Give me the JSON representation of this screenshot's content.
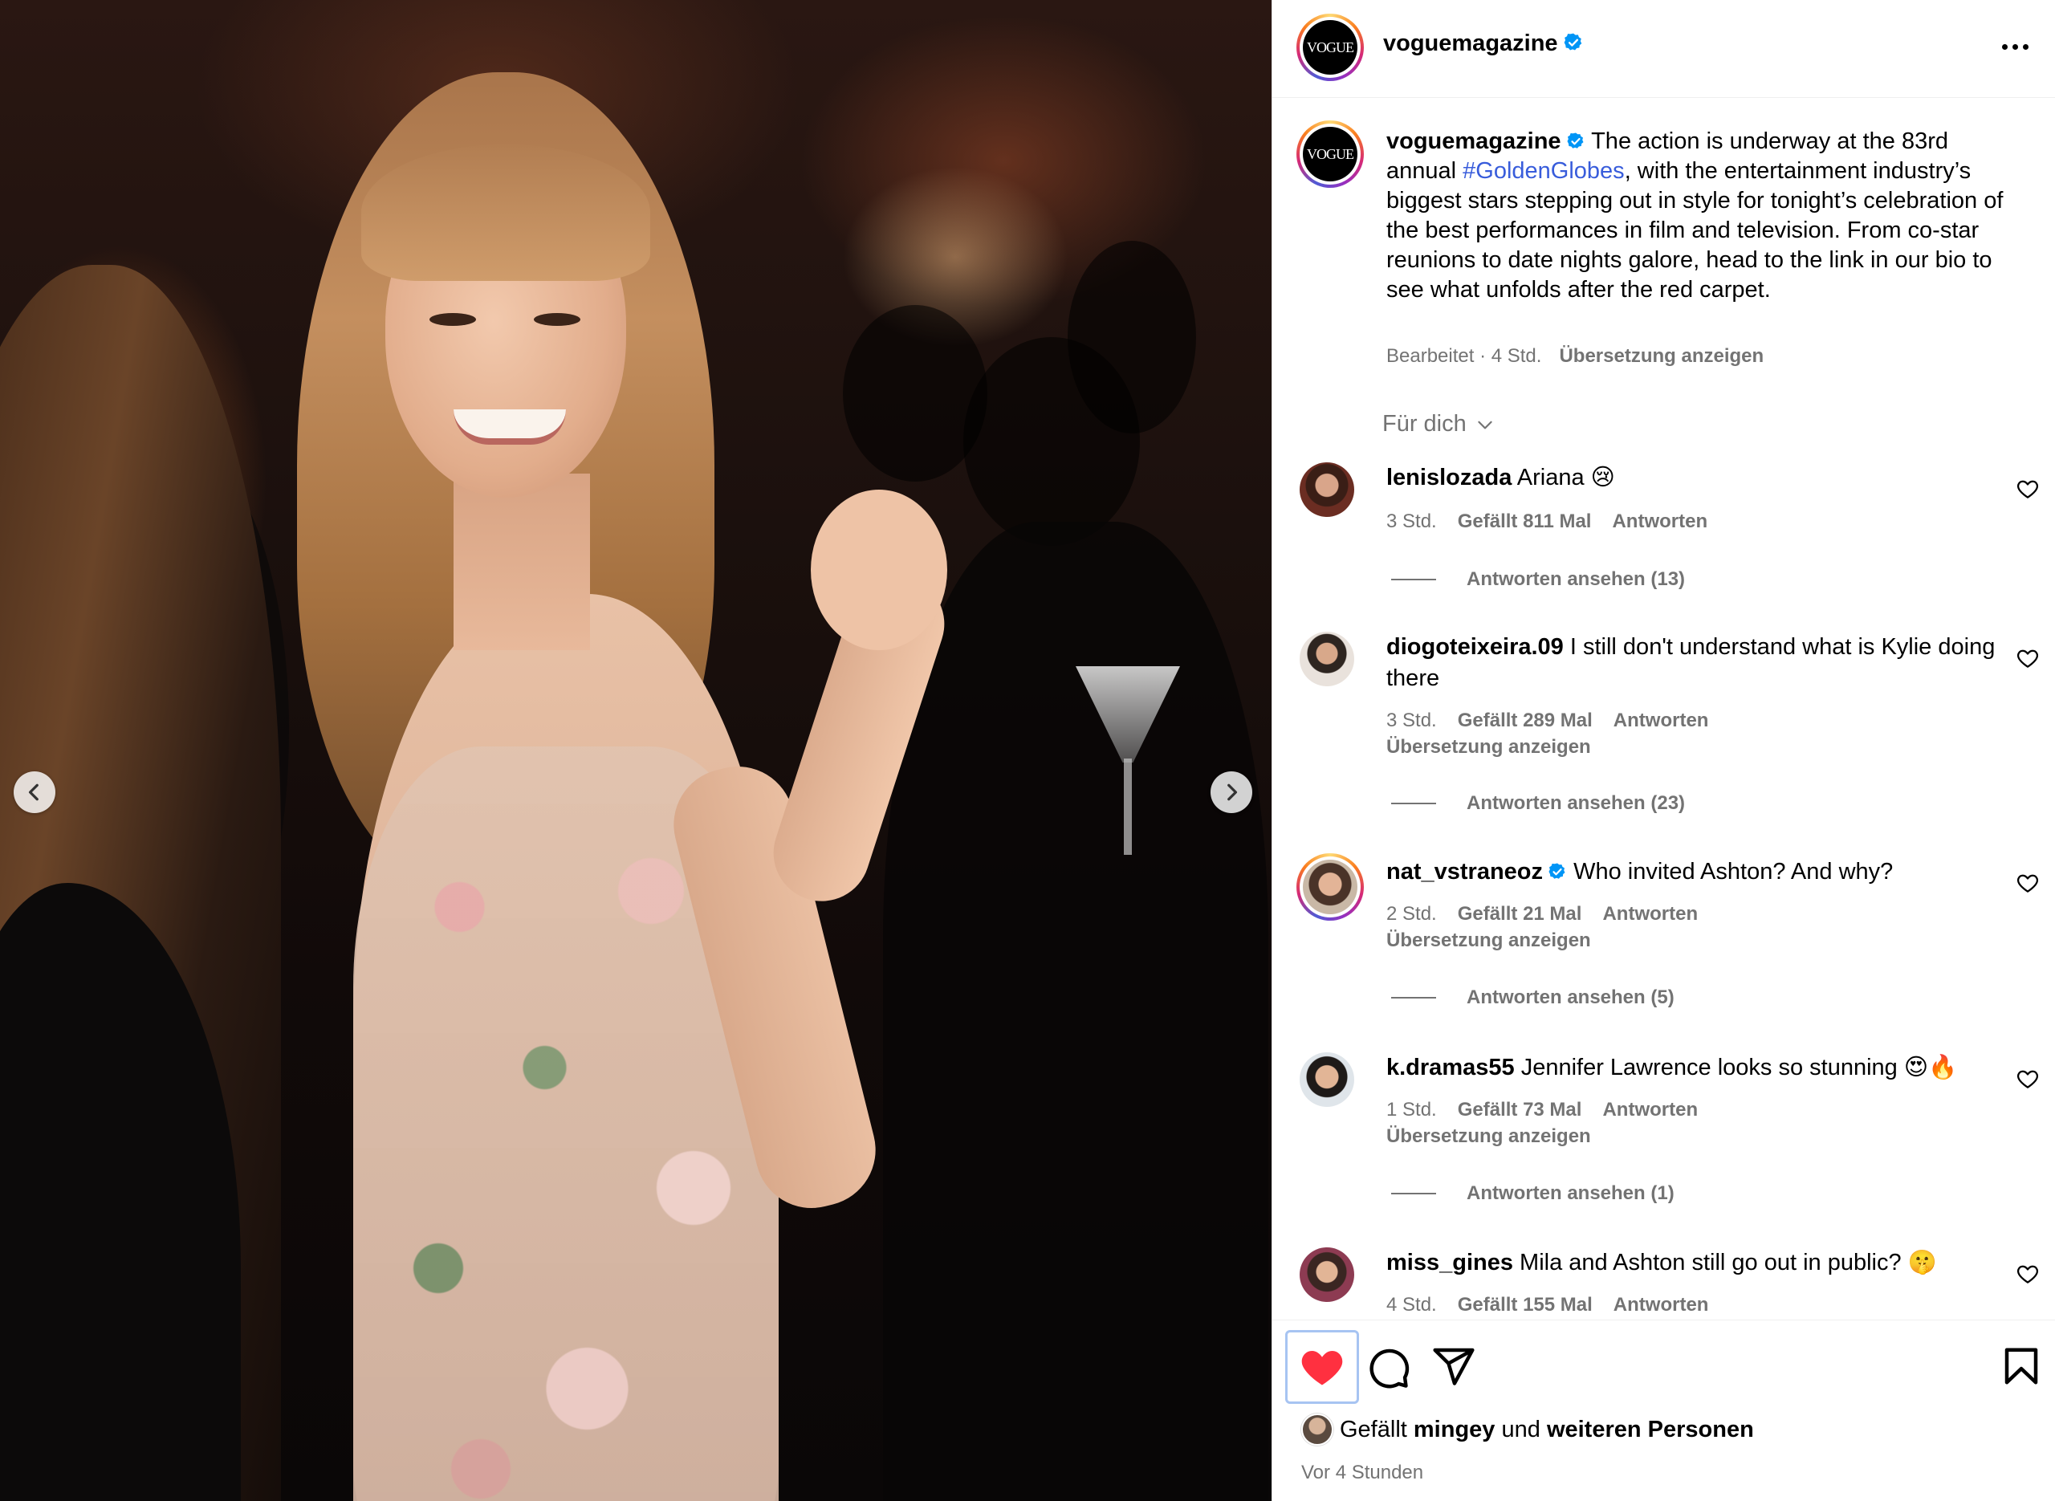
{
  "post": {
    "username": "voguemagazine",
    "avatar_text": "VOGUE",
    "more_icon": "more-horizontal-icon"
  },
  "caption": {
    "username": "voguemagazine",
    "text_before": " The action is underway at the 83rd annual ",
    "hashtag": "#GoldenGlobes",
    "text_after": ", with the entertainment industry’s biggest stars stepping out in style for tonight’s celebration of the best performances in film and television. From co-star reunions to date nights galore, head to the link in our bio to see what unfolds after the red carpet.",
    "meta_prefix": "Bearbeitet · 4 Std.",
    "translate": "Übersetzung anzeigen"
  },
  "sort": {
    "label": "Für dich"
  },
  "comments": [
    {
      "username": "lenislozada",
      "text": "Ariana 😢",
      "time": "3 Std.",
      "likes": "Gefällt 811 Mal",
      "reply": "Antworten",
      "view_replies": "Antworten ansehen (13)"
    },
    {
      "username": "diogoteixeira.09",
      "text": "I still don't understand what is Kylie doing there",
      "time": "3 Std.",
      "likes": "Gefällt 289 Mal",
      "reply": "Antworten",
      "translate": "Übersetzung anzeigen",
      "view_replies": "Antworten ansehen (23)"
    },
    {
      "username": "nat_vstraneoz",
      "text": "Who invited Ashton? And why?",
      "time": "2 Std.",
      "likes": "Gefällt 21 Mal",
      "reply": "Antworten",
      "translate": "Übersetzung anzeigen",
      "view_replies": "Antworten ansehen (5)"
    },
    {
      "username": "k.dramas55",
      "text": "Jennifer Lawrence looks so stunning 😍🔥",
      "time": "1 Std.",
      "likes": "Gefällt 73 Mal",
      "reply": "Antworten",
      "translate": "Übersetzung anzeigen",
      "view_replies": "Antworten ansehen (1)"
    },
    {
      "username": "miss_gines",
      "text": "Mila and Ashton still go out in public? 🤫",
      "time": "4 Std.",
      "likes": "Gefällt 155 Mal",
      "reply": "Antworten"
    }
  ],
  "actions": {
    "liked": true,
    "like_color": "#ff3040"
  },
  "likes": {
    "prefix": "Gefällt",
    "user": "mingey",
    "middle": "und",
    "others": "weiteren Personen"
  },
  "time_ago": "Vor 4 Stunden",
  "colors": {
    "verified": "#0095f6",
    "secondary_text": "#737373",
    "hashtag": "#385cdb"
  }
}
